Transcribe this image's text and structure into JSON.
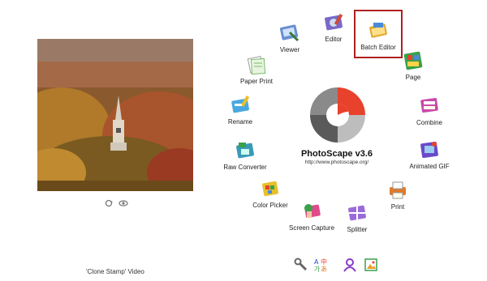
{
  "photo_caption": "'Clone Stamp' Video",
  "brand": {
    "title": "PhotoScape v3.6",
    "url": "http://www.photoscape.org/"
  },
  "tools": {
    "viewer": "Viewer",
    "editor": "Editor",
    "batch_editor": "Batch Editor",
    "page": "Page",
    "combine": "Combine",
    "animated_gif": "Animated GIF",
    "print": "Print",
    "splitter": "Splitter",
    "screen_capture": "Screen Capture",
    "color_picker": "Color Picker",
    "raw_converter": "Raw Converter",
    "rename": "Rename",
    "paper_print": "Paper Print"
  },
  "bottom_bar": {
    "language_glyphs": [
      "A",
      "中",
      "가",
      "あ"
    ]
  },
  "colors": {
    "logo_red": "#e8412c",
    "logo_gray": "#5a5a5a",
    "highlight": "#b02020"
  }
}
